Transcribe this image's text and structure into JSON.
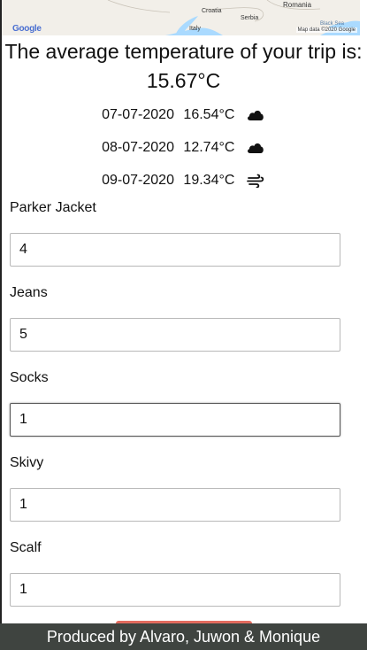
{
  "map": {
    "labels": [
      "Romania",
      "Croatia",
      "Serbia",
      "Italy",
      "Black Sea"
    ],
    "google_logo": "Google",
    "attribution": "Map data ©2020 Google"
  },
  "trip": {
    "title": "The average temperature of your trip is: 15.67°C"
  },
  "forecast": [
    {
      "date": "07-07-2020",
      "temp": "16.54°C",
      "icon": "cloud-icon"
    },
    {
      "date": "08-07-2020",
      "temp": "12.74°C",
      "icon": "cloud-icon"
    },
    {
      "date": "09-07-2020",
      "temp": "19.34°C",
      "icon": "wind-icon"
    }
  ],
  "items": [
    {
      "label": "Parker Jacket",
      "value": "4"
    },
    {
      "label": "Jeans",
      "value": "5"
    },
    {
      "label": "Socks",
      "value": "1"
    },
    {
      "label": "Skivy",
      "value": "1"
    },
    {
      "label": "Scalf",
      "value": "1"
    }
  ],
  "footer": {
    "text": "Produced by Alvaro, Juwon & Monique"
  },
  "colors": {
    "footer_bg": "#3f4440",
    "submit_button": "#e26b5e",
    "map_water": "#aadaff",
    "map_land": "#f2efe9"
  }
}
